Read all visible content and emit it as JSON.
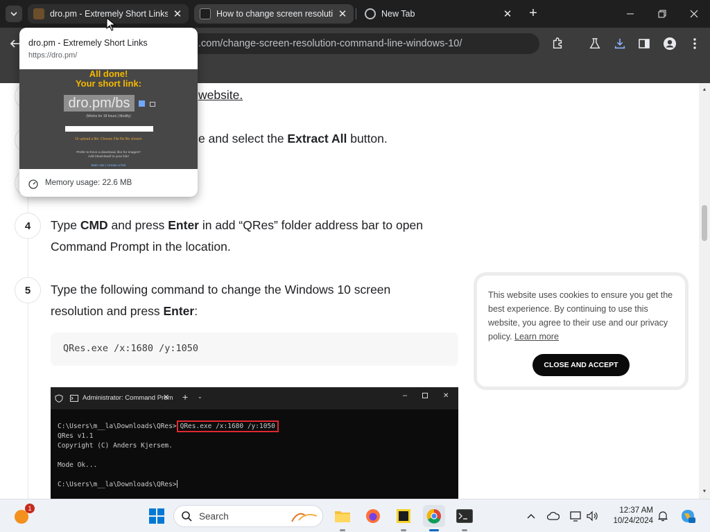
{
  "browser": {
    "tabs": [
      {
        "title": "dro.pm - Extremely Short Links",
        "active": false
      },
      {
        "title": "How to change screen resolution",
        "active": true
      },
      {
        "title": "New Tab",
        "active": false
      }
    ],
    "address_host": "",
    "address_path": ".com/change-screen-resolution-command-line-windows-10/"
  },
  "hover_card": {
    "title": "dro.pm - Extremely Short Links",
    "url": "https://dro.pm/",
    "preview": {
      "done_line1": "All done!",
      "done_line2": "Your short link:",
      "short_link": "dro.pm/bs",
      "works_note": "(Works for 18 hours | Modify)",
      "upload_note": "Or upload a file: Choose File  No file chosen",
      "prefer_note_1": "Prefer to force a download, like for images?",
      "prefer_note_2": "Add /download/ to your link!",
      "links": "Main site | Create a link"
    },
    "memory": "Memory usage: 22.6 MB"
  },
  "article": {
    "step_partial_link": "website.",
    "step_partial_2a": "e and select the ",
    "step_partial_2b": "Extract All",
    "step_partial_2c": " button.",
    "step4_number": "4",
    "step4_a": "Type ",
    "step4_b": "CMD",
    "step4_c": " and press ",
    "step4_d": "Enter",
    "step4_e": " in add “QRes” folder address bar to open",
    "step4_f": "Command Prompt in the location.",
    "step5_number": "5",
    "step5_a": "Type the following command to change the Windows 10 screen",
    "step5_b": "resolution and press ",
    "step5_c": "Enter",
    "step5_d": ":",
    "code": "QRes.exe /x:1680 /y:1050"
  },
  "terminal": {
    "title": "Administrator: Command Prom",
    "line1_prompt": "C:\\Users\\m__la\\Downloads\\QRes>",
    "line1_cmd": "QRes.exe /x:1680 /y:1050",
    "line2": "QRes v1.1",
    "line3": "Copyright (C) Anders Kjersem.",
    "line4": "Mode Ok...",
    "line5": "C:\\Users\\m__la\\Downloads\\QRes>"
  },
  "cookie": {
    "text": "This website uses cookies to ensure you get the best experience. By continuing to use this website, you agree to their use and our privacy policy.",
    "learn_more": "Learn more",
    "button": "CLOSE AND ACCEPT"
  },
  "taskbar": {
    "search_label": "Search",
    "time": "12:37 AM",
    "date": "10/24/2024",
    "notification_count": "1"
  },
  "colors": {
    "tab_strip": "#1f1f1f",
    "toolbar": "#3c3c3c",
    "accent_orange": "#f5b800",
    "highlight_red": "#e0282f",
    "cookie_button": "#0a0a0a"
  }
}
